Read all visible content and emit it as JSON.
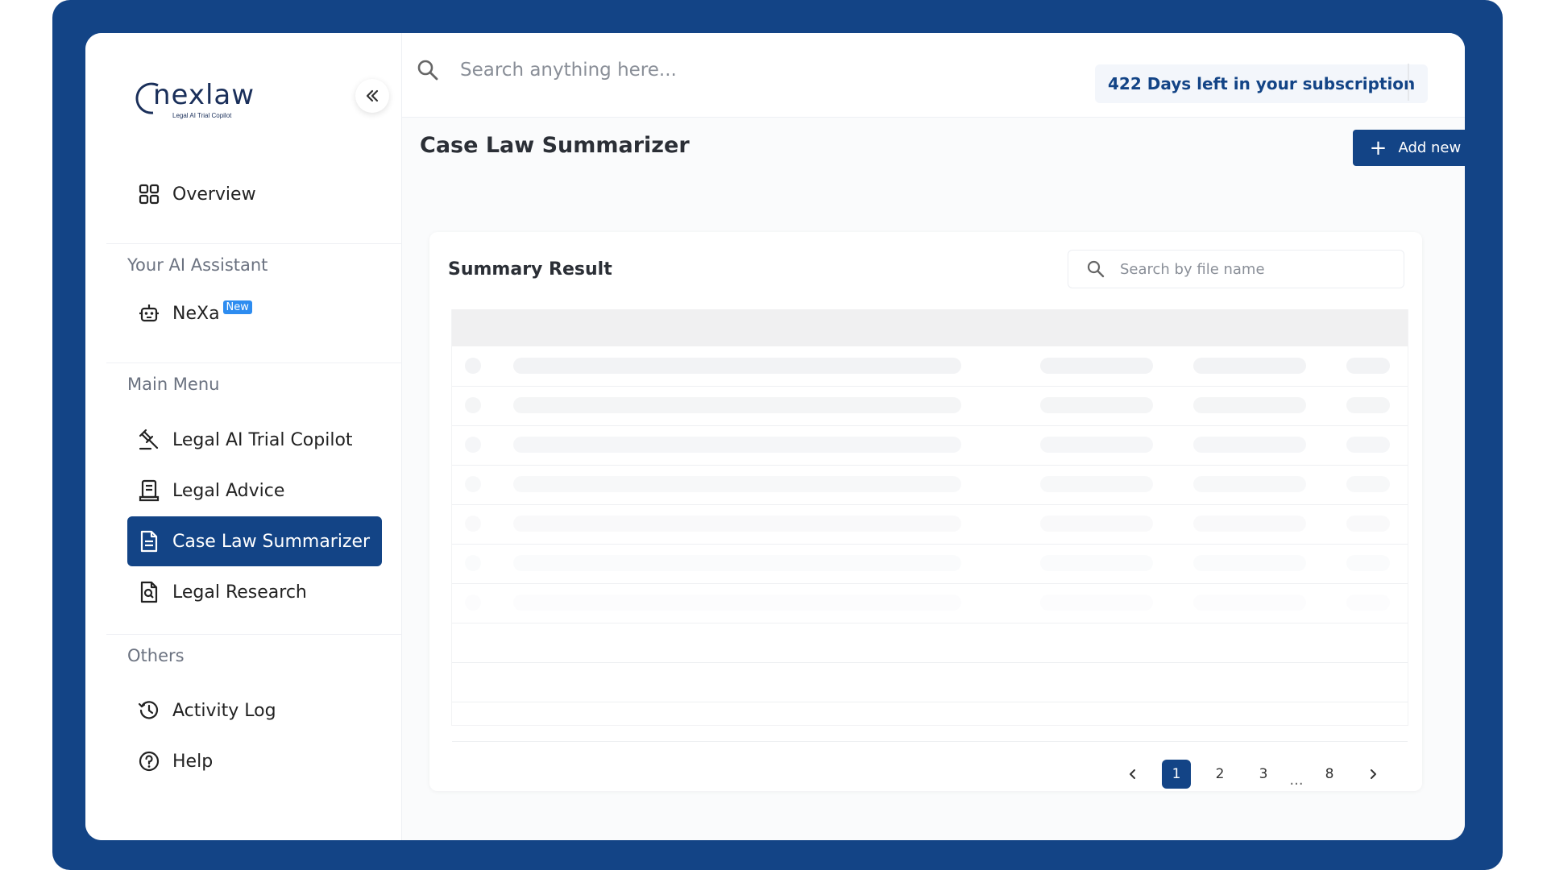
{
  "brand": {
    "name": "nexlaw",
    "tagline": "Legal AI Trial Copilot",
    "primary_color": "#134486"
  },
  "sidebar": {
    "overview": {
      "label": "Overview",
      "icon": "grid-icon"
    },
    "assistant_section": "Your AI Assistant",
    "nexa": {
      "label": "NeXa",
      "badge": "New",
      "icon": "robot-icon"
    },
    "main_section": "Main Menu",
    "items": [
      {
        "label": "Legal AI Trial Copilot",
        "icon": "gavel-icon",
        "active": false
      },
      {
        "label": "Legal Advice",
        "icon": "scroll-icon",
        "active": false
      },
      {
        "label": "Case Law Summarizer",
        "icon": "document-icon",
        "active": true
      },
      {
        "label": "Legal Research",
        "icon": "file-search-icon",
        "active": false
      }
    ],
    "others_section": "Others",
    "others": [
      {
        "label": "Activity Log",
        "icon": "history-icon"
      },
      {
        "label": "Help",
        "icon": "help-icon"
      }
    ]
  },
  "header": {
    "search_placeholder": "Search anything here...",
    "subscription": "422 Days left in your subscription"
  },
  "page": {
    "title": "Case Law Summarizer",
    "add_button": "Add new case"
  },
  "summary": {
    "title": "Summary Result",
    "search_placeholder": "Search by file name",
    "loading_rows": 7
  },
  "pagination": {
    "pages": [
      "1",
      "2",
      "3",
      "8"
    ],
    "ellipsis": "...",
    "current": "1"
  }
}
